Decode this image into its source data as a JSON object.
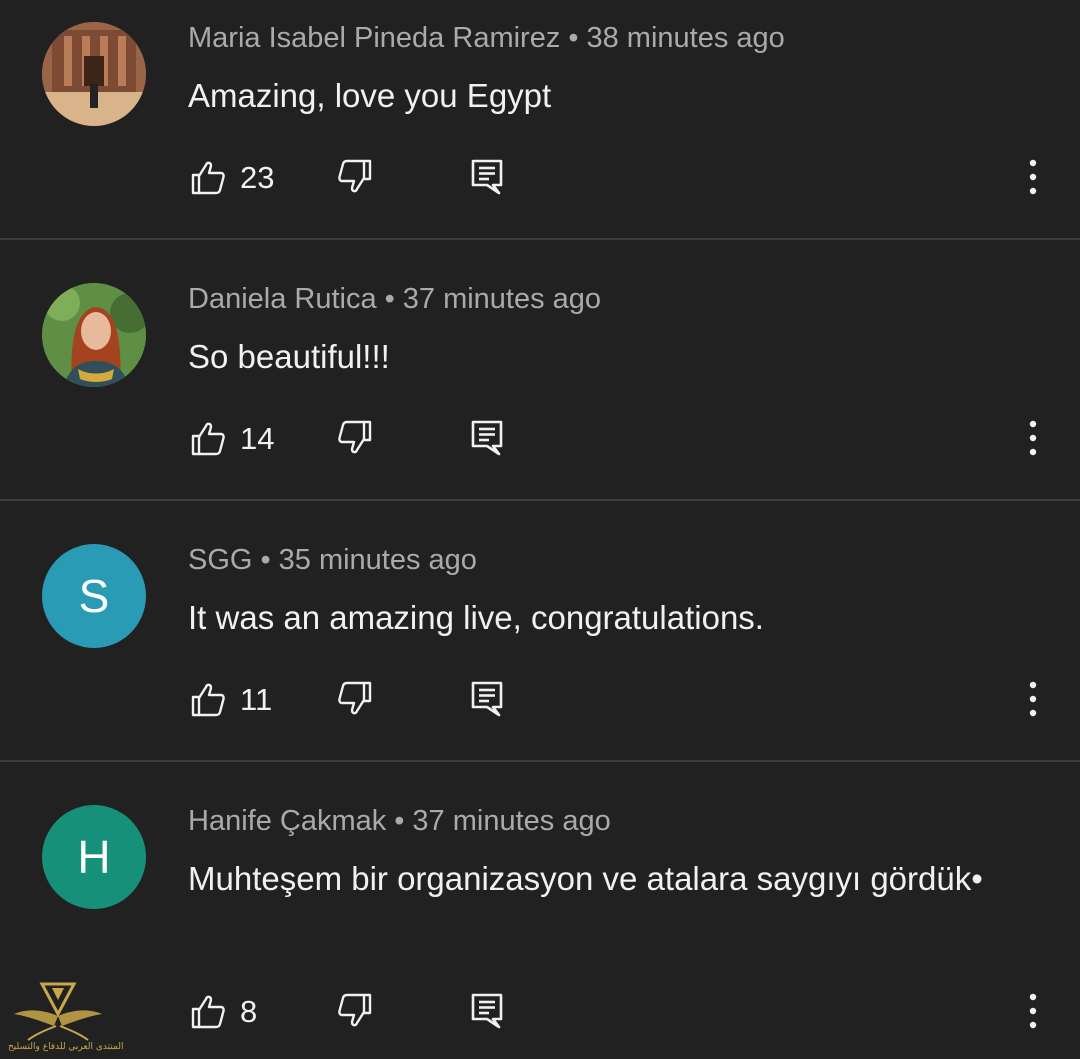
{
  "comments": [
    {
      "author": "Maria Isabel Pineda Ramirez",
      "time": "38 minutes ago",
      "text": "Amazing, love you Egypt",
      "likes": "23",
      "avatar_type": "photo-petra"
    },
    {
      "author": "Daniela Rutica",
      "time": "37 minutes ago",
      "text": "So beautiful!!!",
      "likes": "14",
      "avatar_type": "photo-portrait"
    },
    {
      "author": "SGG",
      "time": "35 minutes ago",
      "text": "It was an amazing live, congratulations.",
      "likes": "11",
      "avatar_letter": "S",
      "avatar_color": "#2a9bb5"
    },
    {
      "author": "Hanife Çakmak",
      "time": "37 minutes ago",
      "text": "Muhteşem bir organizasyon ve atalara saygıyı gördük•",
      "likes": "8",
      "avatar_letter": "H",
      "avatar_color": "#17907a"
    }
  ],
  "separator": "•",
  "icons": {
    "like": "thumb-up-icon",
    "dislike": "thumb-down-icon",
    "reply": "reply-icon",
    "more": "more-vert-icon"
  },
  "watermark": {
    "text": "المنتدى العربي للدفاع والتسليح",
    "color": "#c9a84a"
  },
  "colors": {
    "background": "#212121",
    "meta": "#aaaaaa",
    "text": "#f1f1f1",
    "divider": "#3d3d3d"
  }
}
